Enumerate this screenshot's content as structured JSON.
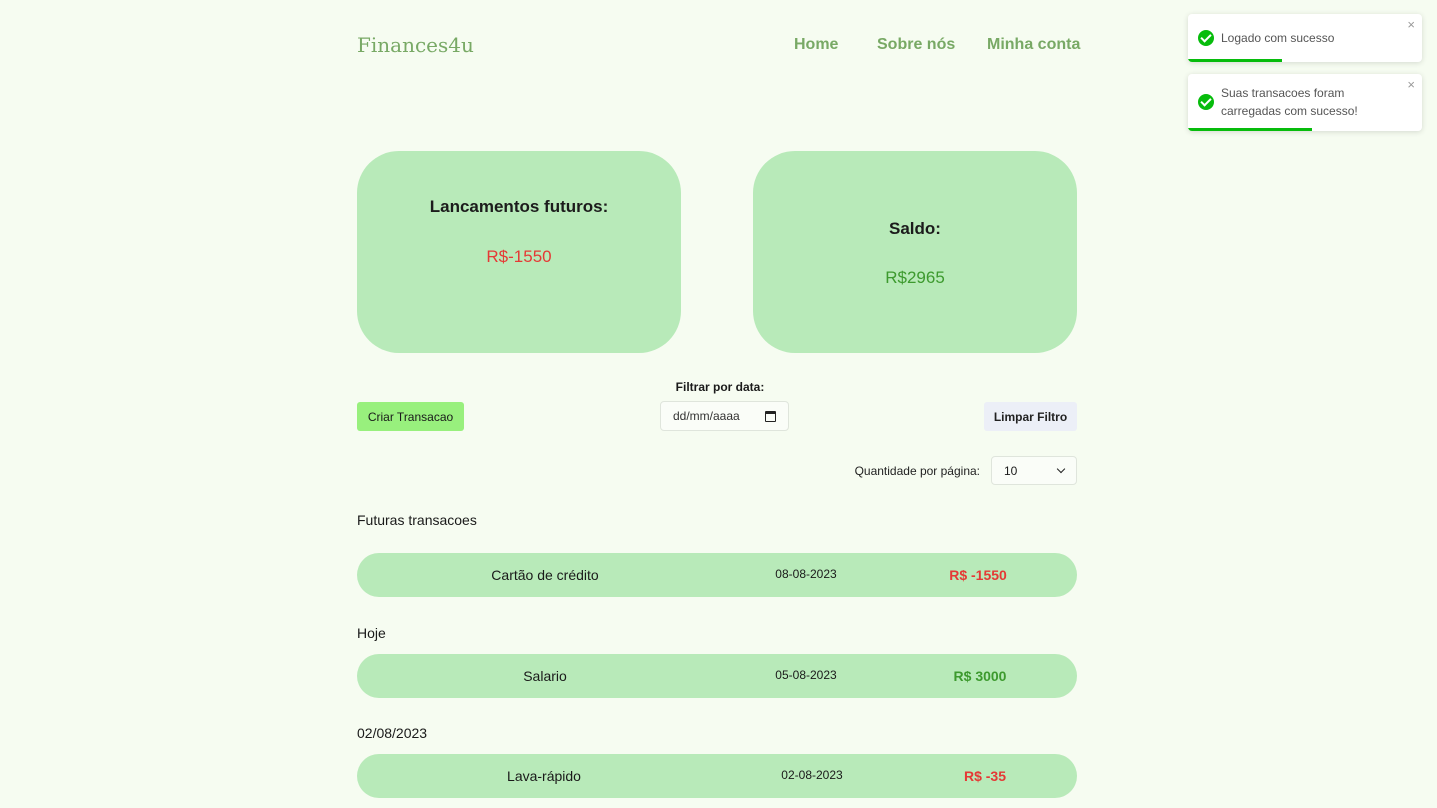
{
  "header": {
    "brand": "Finances4u",
    "nav": [
      "Home",
      "Sobre nós",
      "Minha conta"
    ]
  },
  "cards": {
    "futuros": {
      "title": "Lancamentos futuros:",
      "value": "R$-1550"
    },
    "saldo": {
      "title": "Saldo:",
      "value": "R$2965"
    }
  },
  "controls": {
    "criar_label": "Criar Transacao",
    "filter_label": "Filtrar por data:",
    "date_placeholder": "dd/mm/aaaa",
    "limpar_label": "Limpar Filtro",
    "qty_label": "Quantidade por página:",
    "qty_value": "10"
  },
  "groups": [
    {
      "title": "Futuras transacoes",
      "items": [
        {
          "name": "Cartão de crédito",
          "date": "08-08-2023",
          "value": "R$ -1550"
        }
      ]
    },
    {
      "title": "Hoje",
      "items": [
        {
          "name": "Salario",
          "date": "05-08-2023",
          "value": "R$ 3000"
        }
      ]
    },
    {
      "title": "02/08/2023",
      "items": [
        {
          "name": "Lava-rápido",
          "date": "02-08-2023",
          "value": "R$ -35"
        }
      ]
    }
  ],
  "toasts": [
    {
      "text": "Logado com sucesso",
      "progress": 0.4
    },
    {
      "text": "Suas transacoes foram carregadas com sucesso!",
      "progress": 0.53
    }
  ],
  "toast_close_glyph": "×",
  "colors": {
    "negative": "#e53935",
    "positive": "#3d9a2e",
    "card": "#b8eab9",
    "brand": "#78a965",
    "toast_success": "#07bc0c"
  }
}
